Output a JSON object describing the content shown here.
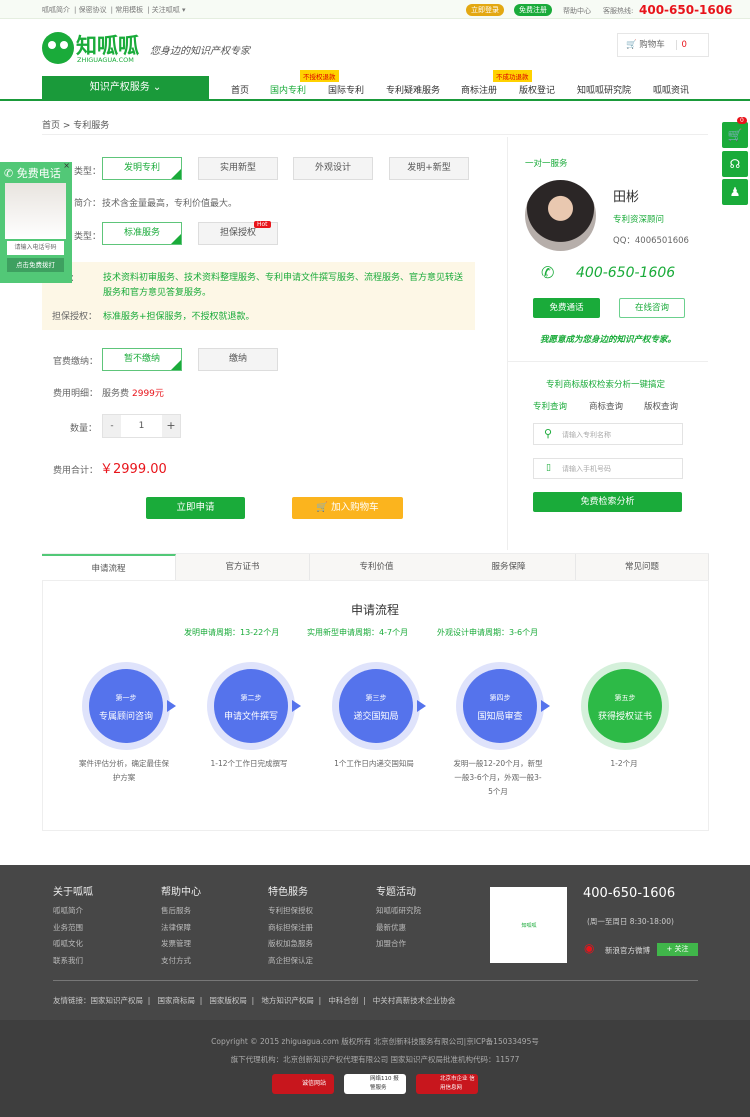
{
  "topbar": {
    "links": [
      "呱呱简介",
      "保密协议",
      "常用模板",
      "关注呱呱 ▾"
    ],
    "login": "立即登录",
    "register": "免费注册",
    "help": "帮助中心",
    "hotline_label": "客服热线:",
    "hotline": "400-650-1606"
  },
  "header": {
    "logo_cn": "知呱呱",
    "logo_en": "ZHIGUAGUA.COM",
    "slogan": "您身边的知识产权专家",
    "cart_label": "购物车",
    "cart_count": "0"
  },
  "nav": {
    "category": "知识产权服务",
    "items": [
      "首页",
      "国内专利",
      "国际专利",
      "专利疑难服务",
      "商标注册",
      "版权登记",
      "知呱呱研究院",
      "呱呱资讯"
    ],
    "badges": [
      "不授权退款",
      "不成功退款"
    ]
  },
  "breadcrumb": "首页 > 专利服务",
  "product": {
    "type_label": "类型：",
    "types": [
      "发明专利",
      "实用新型",
      "外观设计",
      "发明+新型"
    ],
    "intro_label": "简介：",
    "intro": "技术含金量最高，专利价值最大。",
    "service_type_label": "类型：",
    "service_types": [
      "标准服务",
      "担保授权"
    ],
    "hot": "Hot",
    "service_label": "服务：",
    "service_text": "技术资料初审服务、技术资料整理服务、专利申请文件撰写服务、流程服务、官方意见转送服务和官方意见答复服务。",
    "guarantee_label": "担保授权：",
    "guarantee_text": "标准服务+担保服务，不授权就退款。",
    "fee_label": "官费缴纳：",
    "fee_options": [
      "暂不缴纳",
      "缴纳"
    ],
    "detail_label": "费用明细：",
    "detail_prefix": "服务费",
    "detail_price": "2999元",
    "qty_label": "数量：",
    "qty_minus": "-",
    "qty": "1",
    "qty_plus": "+",
    "total_label": "费用合计：",
    "total": "￥2999.00",
    "apply": "立即申请",
    "add_cart": "加入购物车"
  },
  "popup": {
    "title": "免费电话",
    "input_placeholder": "请输入电话号码",
    "call": "点击免费拨打"
  },
  "advisor": {
    "section": "一对一服务",
    "name": "田彬",
    "title": "专利资深顾问",
    "qq": "QQ：4006501606",
    "phone": "400-650-1606",
    "call": "免费通话",
    "consult": "在线咨询",
    "motto": "我愿意成为您身边的知识产权专家。"
  },
  "search": {
    "title": "专利商标版权检索分析一键搞定",
    "tabs": [
      "专利查询",
      "商标查询",
      "版权查询"
    ],
    "name_placeholder": "请输入专利名称",
    "phone_placeholder": "请输入手机号码",
    "submit": "免费检索分析"
  },
  "side_cart_count": "0",
  "tabs": [
    "申请流程",
    "官方证书",
    "专利价值",
    "服务保障",
    "常见问题"
  ],
  "process": {
    "title": "申请流程",
    "periods": [
      "发明申请周期：13-22个月",
      "实用新型申请周期：4-7个月",
      "外观设计申请周期：3-6个月"
    ],
    "steps": [
      {
        "no": "第一步",
        "name": "专属顾问咨询",
        "desc": "案件评估分析，确定最佳保护方案"
      },
      {
        "no": "第二步",
        "name": "申请文件撰写",
        "desc": "1-12个工作日完成撰写"
      },
      {
        "no": "第三步",
        "name": "递交国知局",
        "desc": "1个工作日内递交国知局"
      },
      {
        "no": "第四步",
        "name": "国知局审查",
        "desc": "发明一般12-20个月，新型一般3-6个月，外观一般3-5个月"
      },
      {
        "no": "第五步",
        "name": "获得授权证书",
        "desc": "1-2个月"
      }
    ]
  },
  "footer": {
    "cols": [
      {
        "h": "关于呱呱",
        "items": [
          "呱呱简介",
          "业务范围",
          "呱呱文化",
          "联系我们"
        ]
      },
      {
        "h": "帮助中心",
        "items": [
          "售后服务",
          "法律保障",
          "发票管理",
          "支付方式"
        ]
      },
      {
        "h": "特色服务",
        "items": [
          "专利担保授权",
          "商标担保注册",
          "版权加急服务",
          "高企担保认定"
        ]
      },
      {
        "h": "专题活动",
        "items": [
          "知呱呱研究院",
          "最新优惠",
          "加盟合作"
        ]
      }
    ],
    "phone": "400-650-1606",
    "hours": "(周一至周日 8:30-18:00)",
    "weibo": "新浪官方微博",
    "follow": "+ 关注",
    "qr_text": "知呱呱",
    "links_label": "友情链接：",
    "links": [
      "国家知识产权局",
      "国家商标局",
      "国家版权局",
      "地方知识产权局",
      "中科合创",
      "中关村高新技术企业协会"
    ],
    "copyright": "Copyright © 2015 zhiguagua.com 版权所有 北京创新科技服务有限公司|京ICP备15033495号",
    "agency": "旗下代理机构：北京创新知识产权代理有限公司 国家知识产权局批准机构代码：11577",
    "badges": [
      "诚信网站",
      "网络110 报警服务",
      "北京市企业 信用信息网"
    ]
  }
}
